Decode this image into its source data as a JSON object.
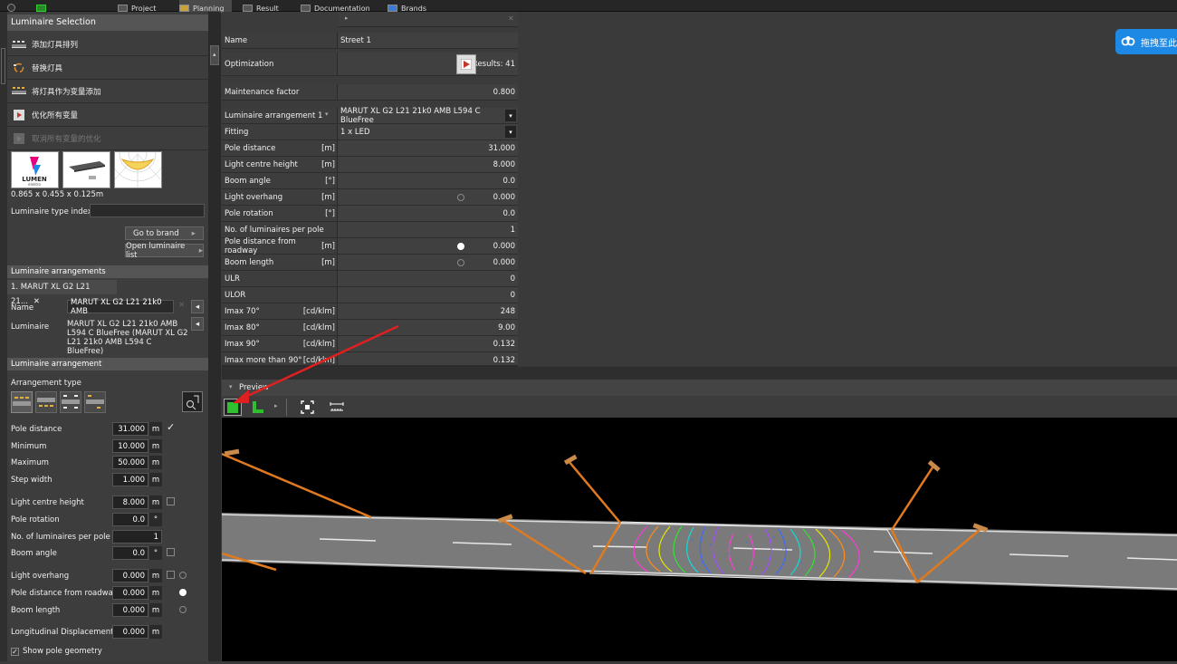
{
  "topmenu": {
    "project": "Project",
    "planning": "Planning",
    "result": "Result",
    "documentation": "Documentation",
    "brands": "Brands"
  },
  "luminaire_selection": {
    "title": "Luminaire Selection",
    "items": [
      {
        "label": "添加灯具排列"
      },
      {
        "label": "替换灯具"
      },
      {
        "label": "将灯具作为变量添加"
      },
      {
        "label": "优化所有变量"
      },
      {
        "label": "取消所有变量的优化"
      }
    ],
    "dimensions": "0.865 x 0.455 x 0.125m",
    "logo_text": "LUMEN",
    "logo_sub": "elektro",
    "type_index_label": "Luminaire type index",
    "type_index_value": "",
    "go_to_brand": "Go to brand",
    "open_list": "Open luminaire list"
  },
  "arrangements": {
    "title": "Luminaire arrangements",
    "tab": "1. MARUT XL G2 L21 21...",
    "name_label": "Name",
    "name_value": "MARUT XL G2 L21 21k0 AMB",
    "luminaire_label": "Luminaire",
    "luminaire_value": "MARUT XL G2 L21 21k0 AMB L594 C BlueFree (MARUT XL G2 L21 21k0 AMB L594 C BlueFree)"
  },
  "arrangement": {
    "title": "Luminaire arrangement",
    "type_label": "Arrangement type",
    "rows": [
      {
        "label": "Pole distance",
        "value": "31.000",
        "unit": "m"
      },
      {
        "label": "Minimum",
        "value": "10.000",
        "unit": "m"
      },
      {
        "label": "Maximum",
        "value": "50.000",
        "unit": "m"
      },
      {
        "label": "Step width",
        "value": "1.000",
        "unit": "m"
      },
      {
        "label": "Light centre height",
        "value": "8.000",
        "unit": "m"
      },
      {
        "label": "Pole rotation",
        "value": "0.0",
        "unit": "°"
      },
      {
        "label": "No. of luminaires per pole",
        "value": "1",
        "unit": ""
      },
      {
        "label": "Boom angle",
        "value": "0.0",
        "unit": "°"
      },
      {
        "label": "Light overhang",
        "value": "0.000",
        "unit": "m"
      },
      {
        "label": "Pole distance from roadway",
        "value": "0.000",
        "unit": "m"
      },
      {
        "label": "Boom length",
        "value": "0.000",
        "unit": "m"
      },
      {
        "label": "Longitudinal Displacement",
        "value": "0.000",
        "unit": "m"
      }
    ],
    "show_pole_geometry": "Show pole geometry"
  },
  "grid": {
    "rows": [
      {
        "key": "Name",
        "unit": "",
        "value": "Street 1"
      },
      {
        "key": "Optimization",
        "unit": "",
        "value": "Results: 41"
      },
      {
        "key": "Maintenance factor",
        "unit": "",
        "value": "0.800"
      },
      {
        "key": "Luminaire arrangement 1",
        "unit": "",
        "value": "MARUT XL G2 L21 21k0 AMB L594 C BlueFree"
      },
      {
        "key": "Fitting",
        "unit": "",
        "value": "1 x LED"
      },
      {
        "key": "Pole distance",
        "unit": "[m]",
        "value": "31.000"
      },
      {
        "key": "Light centre height",
        "unit": "[m]",
        "value": "8.000"
      },
      {
        "key": "Boom angle",
        "unit": "[°]",
        "value": "0.0"
      },
      {
        "key": "Light overhang",
        "unit": "[m]",
        "value": "0.000"
      },
      {
        "key": "Pole rotation",
        "unit": "[°]",
        "value": "0.0"
      },
      {
        "key": "No. of luminaires per pole",
        "unit": "",
        "value": "1"
      },
      {
        "key": "Pole distance from roadway",
        "unit": "[m]",
        "value": "0.000"
      },
      {
        "key": "Boom length",
        "unit": "[m]",
        "value": "0.000"
      },
      {
        "key": "ULR",
        "unit": "",
        "value": "0"
      },
      {
        "key": "ULOR",
        "unit": "",
        "value": "0"
      },
      {
        "key": "Imax 70°",
        "unit": "[cd/klm]",
        "value": "248"
      },
      {
        "key": "Imax 80°",
        "unit": "[cd/klm]",
        "value": "9.00"
      },
      {
        "key": "Imax 90°",
        "unit": "[cd/klm]",
        "value": "0.132"
      },
      {
        "key": "Imax more than 90°",
        "unit": "[cd/klm]",
        "value": "0.132"
      }
    ]
  },
  "preview": {
    "title": "Preview"
  },
  "badge": {
    "text": "拖拽至此"
  },
  "colors": {
    "accent": "#1e88e5",
    "pole": "#e07a20",
    "road": "#7a7a7a",
    "active_tool": "#2fbf2f"
  }
}
